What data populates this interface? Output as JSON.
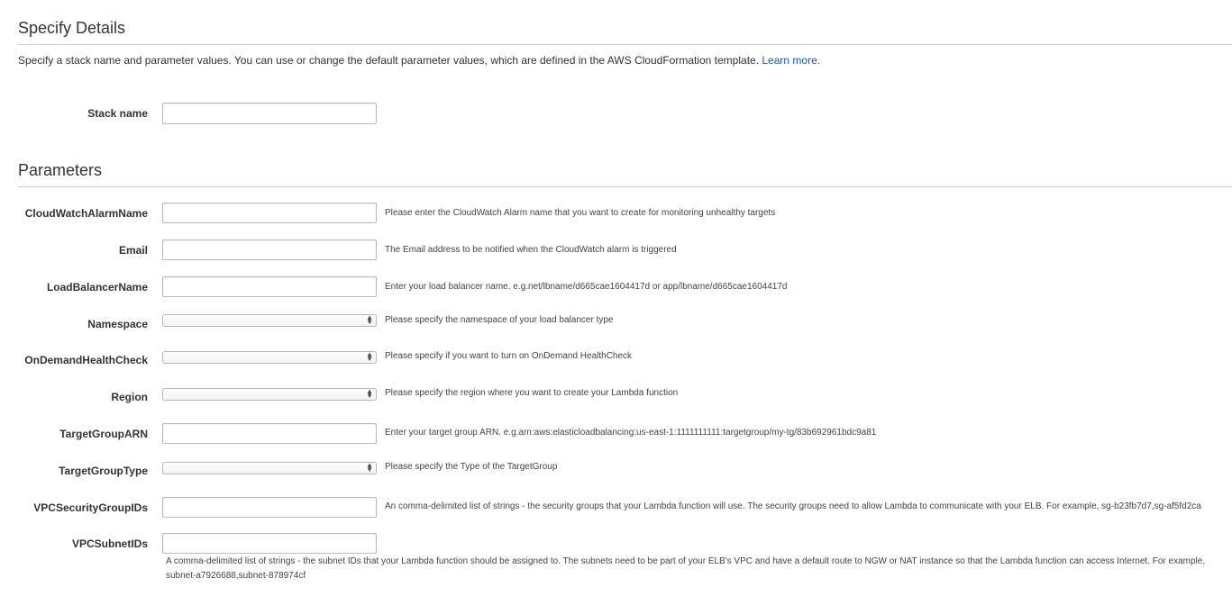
{
  "details": {
    "title": "Specify Details",
    "intro": "Specify a stack name and parameter values. You can use or change the default parameter values, which are defined in the AWS CloudFormation template.",
    "learn_more": "Learn more.",
    "stack_name_label": "Stack name",
    "stack_name_value": ""
  },
  "parameters": {
    "title": "Parameters",
    "cloudwatch_alarm_name": {
      "label": "CloudWatchAlarmName",
      "value": "",
      "help": "Please enter the CloudWatch Alarm name that you want to create for monitoring unhealthy targets"
    },
    "email": {
      "label": "Email",
      "value": "",
      "help": "The Email address to be notified when the CloudWatch alarm is triggered"
    },
    "load_balancer_name": {
      "label": "LoadBalancerName",
      "value": "",
      "help": "Enter your load balancer name. e.g.net/lbname/d665cae1604417d or app/lbname/d665cae1604417d"
    },
    "namespace": {
      "label": "Namespace",
      "selected": "",
      "help": "Please specify the namespace of your load balancer type"
    },
    "on_demand_health_check": {
      "label": "OnDemandHealthCheck",
      "selected": "",
      "help": "Please specify if you want to turn on OnDemand HealthCheck"
    },
    "region": {
      "label": "Region",
      "selected": "",
      "help": "Please specify the region where you want to create your Lambda function"
    },
    "target_group_arn": {
      "label": "TargetGroupARN",
      "value": "",
      "help": "Enter your target group ARN. e.g.arn:aws:elasticloadbalancing:us-east-1:1111111111:targetgroup/my-tg/83b692961bdc9a81"
    },
    "target_group_type": {
      "label": "TargetGroupType",
      "selected": "",
      "help": "Please specify the Type of the TargetGroup"
    },
    "vpc_security_group_ids": {
      "label": "VPCSecurityGroupIDs",
      "value": "",
      "help": "An comma-delimited list of strings - the security groups that your Lambda function will use. The security groups need to allow Lambda to communicate with your ELB. For example, sg-b23fb7d7,sg-af5fd2ca"
    },
    "vpc_subnet_ids": {
      "label": "VPCSubnetIDs",
      "value": "",
      "help": "A comma-delimited list of strings - the subnet IDs that your Lambda function should be assigned to. The subnets need to be part of your ELB's VPC and have a default route to NGW or NAT instance so that the Lambda function can access Internet. For example, subnet-a7926688,subnet-878974cf"
    }
  },
  "icons": {
    "select_arrow_up": "▲",
    "select_arrow_down": "▼"
  },
  "colors": {
    "link": "#1a5ab3",
    "rule": "#cccccc",
    "text": "#333333"
  }
}
